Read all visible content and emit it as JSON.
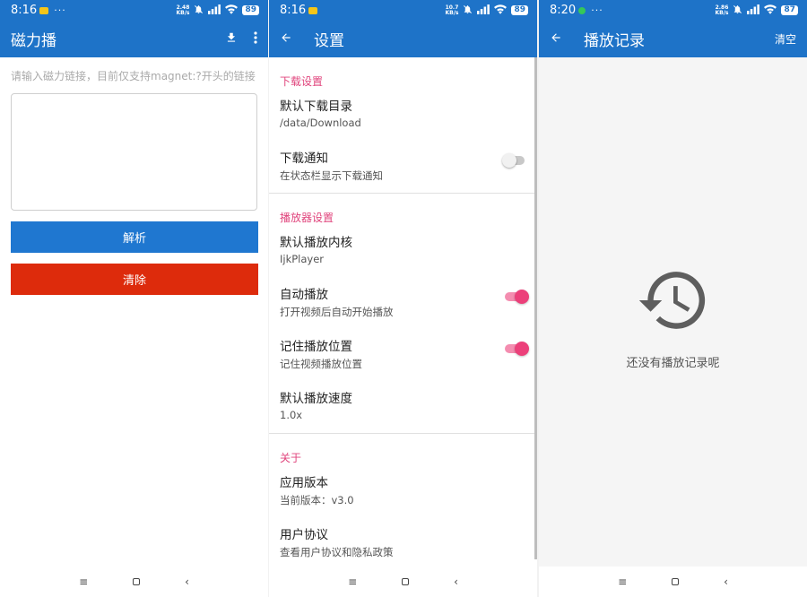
{
  "screen1": {
    "status": {
      "time": "8:16",
      "dots": "···",
      "net_speed_top": "2.48",
      "net_speed_unit": "KB/s",
      "battery": "89",
      "notif_color": "#f5c518"
    },
    "appbar": {
      "title": "磁力播",
      "download_icon": "download-icon",
      "more_icon": "more-vert-icon"
    },
    "hint": "请输入磁力链接，目前仅支持magnet:?开头的链接",
    "input_value": "",
    "parse_label": "解析",
    "clear_label": "清除",
    "colors": {
      "primary": "#1e73c8",
      "parse": "#1f77d0",
      "clear": "#dd2b0c"
    }
  },
  "screen2": {
    "status": {
      "time": "8:16",
      "net_speed_top": "10.7",
      "net_speed_unit": "KB/s",
      "battery": "89"
    },
    "appbar": {
      "title": "设置"
    },
    "sections": [
      {
        "label": "下载设置",
        "items": [
          {
            "title": "默认下载目录",
            "subtitle": "/data/Download"
          },
          {
            "title": "下载通知",
            "subtitle": "在状态栏显示下载通知",
            "toggle": "off"
          }
        ]
      },
      {
        "label": "播放器设置",
        "items": [
          {
            "title": "默认播放内核",
            "subtitle": "IjkPlayer"
          },
          {
            "title": "自动播放",
            "subtitle": "打开视频后自动开始播放",
            "toggle": "on"
          },
          {
            "title": "记住播放位置",
            "subtitle": "记住视频播放位置",
            "toggle": "on"
          },
          {
            "title": "默认播放速度",
            "subtitle": "1.0x"
          }
        ]
      },
      {
        "label": "关于",
        "items": [
          {
            "title": "应用版本",
            "subtitle": "当前版本：v3.0"
          },
          {
            "title": "用户协议",
            "subtitle": "查看用户协议和隐私政策"
          }
        ]
      }
    ],
    "accent": "#e0447c"
  },
  "screen3": {
    "status": {
      "time": "8:20",
      "dots": "···",
      "net_speed_top": "2.86",
      "net_speed_unit": "KB/s",
      "battery": "87",
      "notif_color": "#35c759"
    },
    "appbar": {
      "title": "播放记录",
      "clear_label": "清空"
    },
    "empty_text": "还没有播放记录呢",
    "empty_icon": "history-icon"
  },
  "navbar": {
    "menu": "≡",
    "back": "‹"
  }
}
